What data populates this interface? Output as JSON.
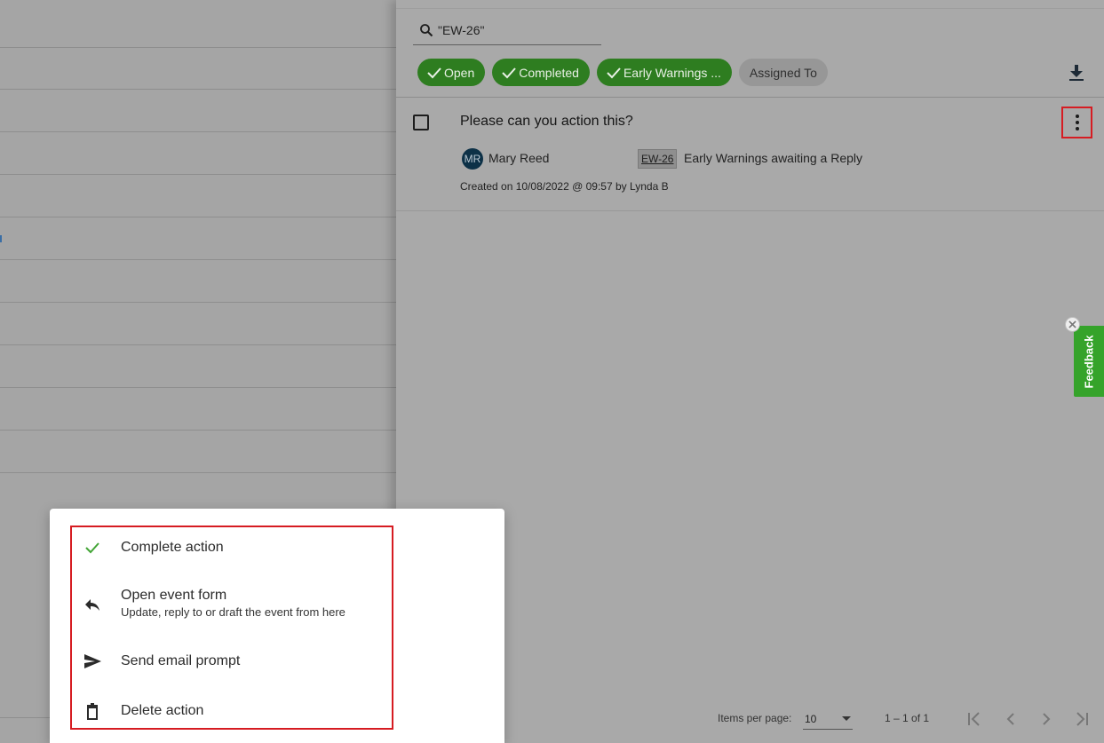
{
  "search": {
    "value": "\"EW-26\""
  },
  "filters": [
    {
      "label": "Open",
      "active": true
    },
    {
      "label": "Completed",
      "active": true
    },
    {
      "label": "Early Warnings ...",
      "active": true
    },
    {
      "label": "Assigned To",
      "active": false
    }
  ],
  "task": {
    "title": "Please can you action this?",
    "assignee_initials": "MR",
    "assignee_name": "Mary Reed",
    "ref_code": "EW-26",
    "ref_description": "Early Warnings awaiting a Reply",
    "created": "Created on 10/08/2022 @ 09:57 by Lynda B"
  },
  "feedback": {
    "label": "Feedback"
  },
  "pagination": {
    "items_per_page_label": "Items per page:",
    "items_per_page_value": "10",
    "range": "1 – 1 of 1"
  },
  "menu": {
    "items": [
      {
        "label": "Complete action",
        "icon": "check-icon"
      },
      {
        "label": "Open event form",
        "sublabel": "Update, reply to or draft the event from here",
        "icon": "reply-icon"
      },
      {
        "label": "Send email prompt",
        "icon": "send-icon"
      },
      {
        "label": "Delete action",
        "icon": "trash-icon"
      }
    ]
  },
  "colors": {
    "chip_active": "#2e7d20",
    "highlight_red": "#d61c22",
    "feedback_green": "#35a32a",
    "check_green": "#43a536"
  }
}
